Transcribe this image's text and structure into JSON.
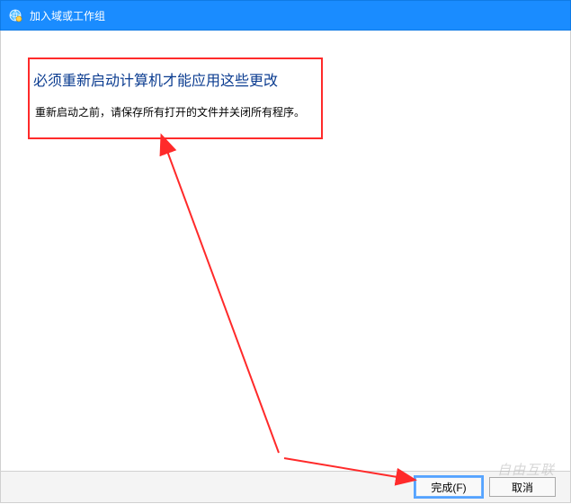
{
  "titlebar": {
    "icon_name": "network-globe-icon",
    "title": "加入域或工作组"
  },
  "message": {
    "heading": "必须重新启动计算机才能应用这些更改",
    "subtext": "重新启动之前，请保存所有打开的文件并关闭所有程序。"
  },
  "footer": {
    "finish_label": "完成(F)",
    "cancel_label": "取消"
  },
  "annotations": {
    "arrow_color": "#ff2a2a",
    "highlight_color": "#ff2a2a"
  },
  "watermark": {
    "text": "自由互联"
  }
}
